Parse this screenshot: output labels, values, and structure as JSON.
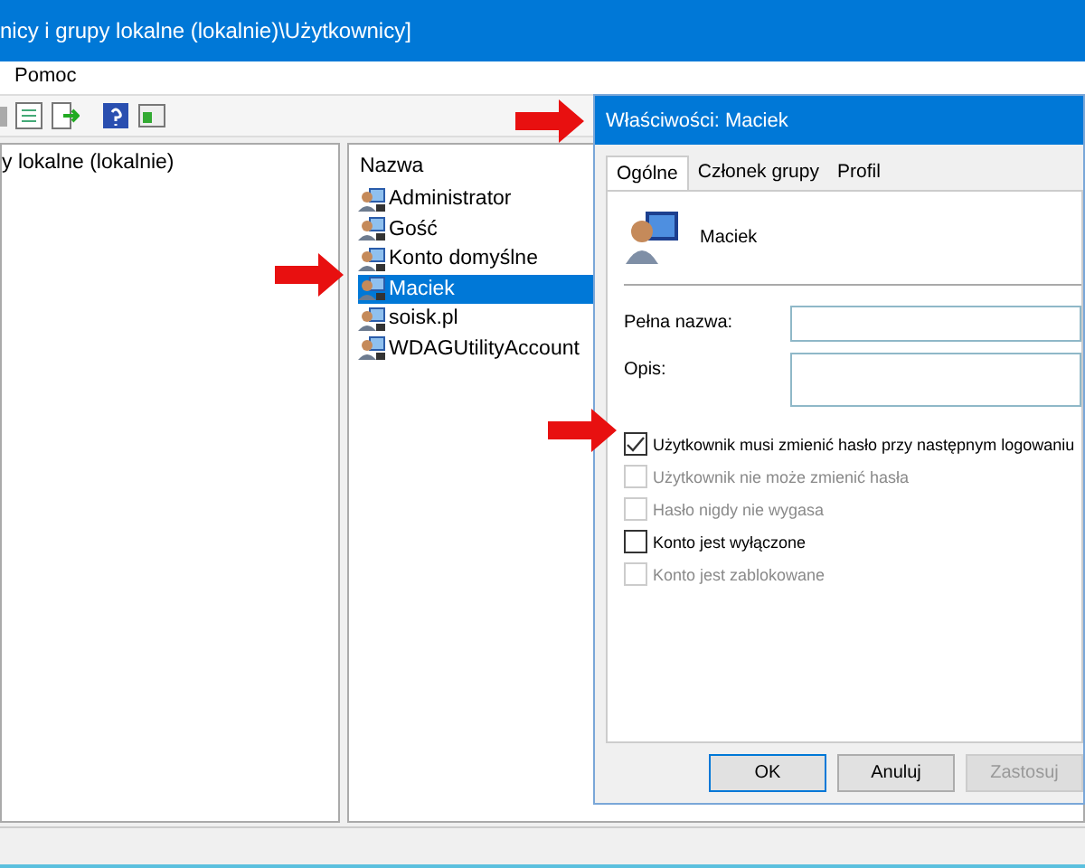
{
  "window": {
    "title": "nicy i grupy lokalne (lokalnie)\\Użytkownicy]"
  },
  "menu": [
    {
      "label": "Pomoc"
    }
  ],
  "tree": {
    "items": [
      {
        "label": "y lokalne (lokalnie)",
        "selected": false
      }
    ]
  },
  "list": {
    "columns": [
      "Nazwa"
    ],
    "items": [
      {
        "name": "Administrator",
        "selected": false
      },
      {
        "name": "Gość",
        "selected": false
      },
      {
        "name": "Konto domyślne",
        "selected": false
      },
      {
        "name": "Maciek",
        "selected": true
      },
      {
        "name": "soisk.pl",
        "selected": false
      },
      {
        "name": "WDAGUtilityAccount",
        "selected": false
      }
    ]
  },
  "dialog": {
    "title": "Właściwości: Maciek",
    "tabs": [
      {
        "label": "Ogólne",
        "selected": true
      },
      {
        "label": "Członek grupy",
        "selected": false
      },
      {
        "label": "Profil",
        "selected": false
      }
    ],
    "user_name": "Maciek",
    "fields": [
      {
        "label": "Pełna nazwa:",
        "kind": "single"
      },
      {
        "label": "Opis:",
        "kind": "multi"
      }
    ],
    "checkboxes": [
      {
        "label": "Użytkownik musi zmienić hasło przy następnym logowaniu",
        "checked": true,
        "disabled": false
      },
      {
        "label": "Użytkownik nie może zmienić hasła",
        "checked": false,
        "disabled": true
      },
      {
        "label": "Hasło nigdy nie wygasa",
        "checked": false,
        "disabled": true
      },
      {
        "label": "Konto jest wyłączone",
        "checked": false,
        "disabled": false
      },
      {
        "label": "Konto jest zablokowane",
        "checked": false,
        "disabled": true
      }
    ],
    "buttons": [
      {
        "label": "OK",
        "default": true,
        "disabled": false
      },
      {
        "label": "Anuluj",
        "default": false,
        "disabled": false
      },
      {
        "label": "Zastosuj",
        "default": false,
        "disabled": true
      }
    ]
  }
}
